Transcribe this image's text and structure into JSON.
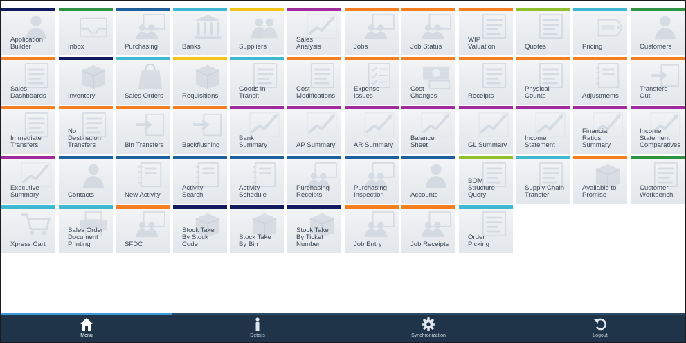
{
  "colors": {
    "orange": "#f57e20",
    "navy": "#101a5c",
    "green": "#2e9444",
    "blue": "#1e5f9c",
    "teal": "#3fb8d2",
    "yellow": "#f2c417",
    "purple": "#a12a9c",
    "lime": "#8fbf2c",
    "bottom_bar": "#1f3448",
    "bottom_bar_active": "#3a9ad9"
  },
  "tiles": [
    {
      "label": "Application\nBuilder",
      "color": "navy",
      "icon": "person-icon"
    },
    {
      "label": "Inbox",
      "color": "green",
      "icon": "inbox-icon"
    },
    {
      "label": "Purchasing",
      "color": "blue",
      "icon": "people-board-icon"
    },
    {
      "label": "Banks",
      "color": "teal",
      "icon": "bank-icon"
    },
    {
      "label": "Suppliers",
      "color": "yellow",
      "icon": "people-icon"
    },
    {
      "label": "Sales\nAnalysis",
      "color": "purple",
      "icon": "chart-icon"
    },
    {
      "label": "Jobs",
      "color": "orange",
      "icon": "people-board-icon"
    },
    {
      "label": "Job Status",
      "color": "orange",
      "icon": "people-board-icon"
    },
    {
      "label": "WIP\nValuation",
      "color": "orange",
      "icon": "document-icon"
    },
    {
      "label": "Quotes",
      "color": "lime",
      "icon": "document-icon"
    },
    {
      "label": "Pricing",
      "color": "teal",
      "icon": "price-tag-icon"
    },
    {
      "label": "Customers",
      "color": "green",
      "icon": "person-icon"
    },
    {
      "label": "Sales\nDashboards",
      "color": "orange",
      "icon": "document-icon"
    },
    {
      "label": "Inventory",
      "color": "navy",
      "icon": "box-icon"
    },
    {
      "label": "Sales Orders",
      "color": "teal",
      "icon": "bag-icon"
    },
    {
      "label": "Requisitions",
      "color": "yellow",
      "icon": "box-icon"
    },
    {
      "label": "Goods in\nTransit",
      "color": "teal",
      "icon": "document-icon"
    },
    {
      "label": "Cost\nModifications",
      "color": "orange",
      "icon": "document-icon"
    },
    {
      "label": "Expense\nIssues",
      "color": "orange",
      "icon": "checklist-icon"
    },
    {
      "label": "Cost\nChanges",
      "color": "orange",
      "icon": "money-icon"
    },
    {
      "label": "Receipts",
      "color": "orange",
      "icon": "document-icon"
    },
    {
      "label": "Physical\nCounts",
      "color": "orange",
      "icon": "document-icon"
    },
    {
      "label": "Adjustments",
      "color": "orange",
      "icon": "notebook-icon"
    },
    {
      "label": "Transfers\nOut",
      "color": "orange",
      "icon": "transfer-icon"
    },
    {
      "label": "Immediate\nTransfers",
      "color": "orange",
      "icon": "document-icon"
    },
    {
      "label": "No\nDestination\nTransfers",
      "color": "orange",
      "icon": "document-icon"
    },
    {
      "label": "Bin Transfers",
      "color": "orange",
      "icon": "transfer-icon"
    },
    {
      "label": "Backflushing",
      "color": "orange",
      "icon": "transfer-icon"
    },
    {
      "label": "Bank\nSummary",
      "color": "purple",
      "icon": "chart-icon"
    },
    {
      "label": "AP Summary",
      "color": "purple",
      "icon": "chart-icon"
    },
    {
      "label": "AR Summary",
      "color": "purple",
      "icon": "chart-icon"
    },
    {
      "label": "Balance\nSheet",
      "color": "purple",
      "icon": "chart-icon"
    },
    {
      "label": "GL Summary",
      "color": "purple",
      "icon": "chart-icon"
    },
    {
      "label": "Income\nStatement",
      "color": "purple",
      "icon": "chart-icon"
    },
    {
      "label": "Financial\nRatios\nSummary",
      "color": "purple",
      "icon": "chart-icon"
    },
    {
      "label": "Income\nStatement\nComparatives",
      "color": "purple",
      "icon": "chart-icon"
    },
    {
      "label": "Executive\nSummary",
      "color": "purple",
      "icon": "chart-icon"
    },
    {
      "label": "Contacts",
      "color": "blue",
      "icon": "person-icon"
    },
    {
      "label": "New Activity",
      "color": "blue",
      "icon": "notebook-icon"
    },
    {
      "label": "Activity\nSearch",
      "color": "blue",
      "icon": "notebook-icon"
    },
    {
      "label": "Activity\nSchedule",
      "color": "blue",
      "icon": "notebook-icon"
    },
    {
      "label": "Purchasing\nReceipts",
      "color": "blue",
      "icon": "people-board-icon"
    },
    {
      "label": "Purchasing\nInspection",
      "color": "blue",
      "icon": "people-board-icon"
    },
    {
      "label": "Accounts",
      "color": "blue",
      "icon": "person-icon"
    },
    {
      "label": "BOM\nStructure\nQuery",
      "color": "lime",
      "icon": "document-icon"
    },
    {
      "label": "Supply Chain\nTransfer",
      "color": "teal",
      "icon": "document-icon"
    },
    {
      "label": "Available to\nPromise",
      "color": "orange",
      "icon": "box-icon"
    },
    {
      "label": "Customer\nWorkbench",
      "color": "green",
      "icon": "document-icon"
    },
    {
      "label": "Xpress Cart",
      "color": "teal",
      "icon": "cart-icon"
    },
    {
      "label": "Sales Order\nDocument\nPrinting",
      "color": "teal",
      "icon": "printer-icon"
    },
    {
      "label": "SFDC",
      "color": "orange",
      "icon": "people-board-icon"
    },
    {
      "label": "Stock Take\nBy Stock\nCode",
      "color": "navy",
      "icon": "box-icon"
    },
    {
      "label": "Stock Take\nBy Bin",
      "color": "navy",
      "icon": "box-icon"
    },
    {
      "label": "Stock Take\nBy Ticket\nNumber",
      "color": "navy",
      "icon": "box-icon"
    },
    {
      "label": "Job Entry",
      "color": "orange",
      "icon": "people-board-icon"
    },
    {
      "label": "Job Receipts",
      "color": "orange",
      "icon": "people-board-icon"
    },
    {
      "label": "Order\nPicking",
      "color": "teal",
      "icon": "document-icon"
    }
  ],
  "bottom_nav": [
    {
      "label": "Menu",
      "icon": "home-icon",
      "active": true
    },
    {
      "label": "Details",
      "icon": "info-icon",
      "active": false
    },
    {
      "label": "Synchronization",
      "icon": "gear-icon",
      "active": false
    },
    {
      "label": "Logout",
      "icon": "logout-icon",
      "active": false
    }
  ]
}
